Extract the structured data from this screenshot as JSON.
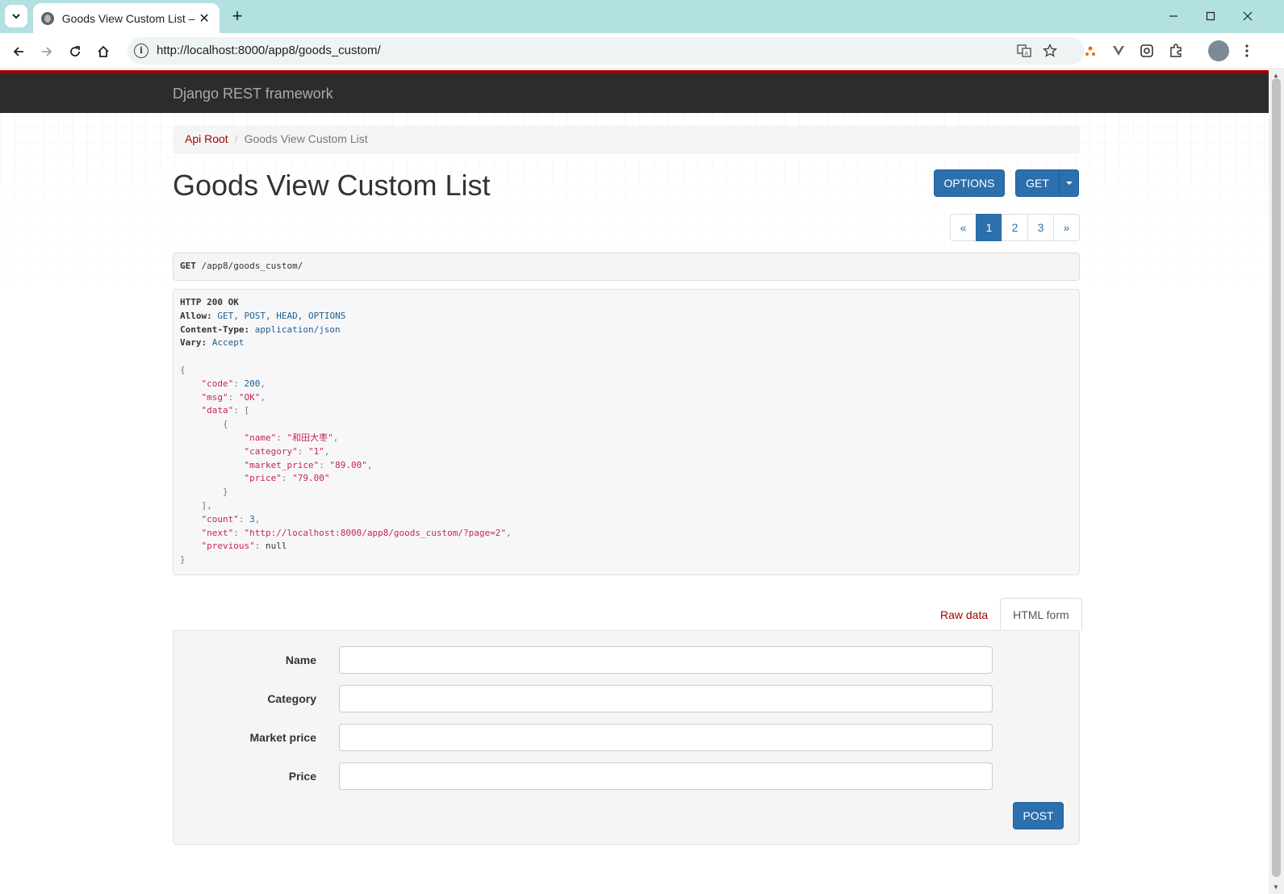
{
  "browser": {
    "tab_title": "Goods View Custom List – Dj",
    "url": "http://localhost:8000/app8/goods_custom/"
  },
  "navbar": {
    "brand": "Django REST framework"
  },
  "breadcrumb": {
    "root": "Api Root",
    "separator": "/",
    "current": "Goods View Custom List"
  },
  "page_title": "Goods View Custom List",
  "buttons": {
    "options": "OPTIONS",
    "get": "GET",
    "post": "POST"
  },
  "pagination": {
    "prev": "«",
    "pages": [
      "1",
      "2",
      "3"
    ],
    "active": "1",
    "next": "»"
  },
  "request": {
    "method": "GET",
    "path": "/app8/goods_custom/"
  },
  "response": {
    "status": "HTTP 200 OK",
    "allow_key": "Allow:",
    "allow_value": "GET, POST, HEAD, OPTIONS",
    "content_type_key": "Content-Type:",
    "content_type_value": "application/json",
    "vary_key": "Vary:",
    "vary_value": "Accept",
    "body": {
      "code": 200,
      "msg": "OK",
      "data": [
        {
          "name": "和田大枣",
          "category": "1",
          "market_price": "89.00",
          "price": "79.00"
        }
      ],
      "count": 3,
      "next": "http://localhost:8000/app8/goods_custom/?page=2",
      "previous": "null"
    }
  },
  "form_tabs": {
    "raw": "Raw data",
    "html": "HTML form"
  },
  "form": {
    "fields": [
      {
        "label": "Name",
        "value": ""
      },
      {
        "label": "Category",
        "value": ""
      },
      {
        "label": "Market price",
        "value": ""
      },
      {
        "label": "Price",
        "value": ""
      }
    ]
  }
}
